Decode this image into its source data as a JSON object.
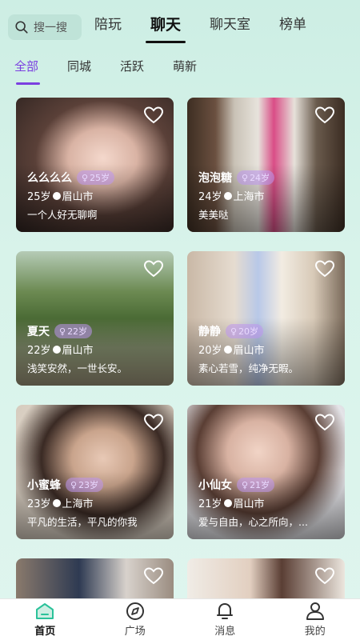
{
  "search": {
    "placeholder": "搜一搜"
  },
  "tabs": [
    {
      "label": "陪玩",
      "active": false
    },
    {
      "label": "聊天",
      "active": true
    },
    {
      "label": "聊天室",
      "active": false
    },
    {
      "label": "榜单",
      "active": false
    }
  ],
  "subtabs": [
    {
      "label": "全部",
      "active": true
    },
    {
      "label": "同城",
      "active": false
    },
    {
      "label": "活跃",
      "active": false
    },
    {
      "label": "萌新",
      "active": false
    }
  ],
  "cards": [
    {
      "name": "么么么么",
      "age_badge": "25岁",
      "age": "25岁",
      "city": "眉山市",
      "bio": "一个人好无聊啊",
      "icon": "heart-outline-icon"
    },
    {
      "name": "泡泡糖",
      "age_badge": "24岁",
      "age": "24岁",
      "city": "上海市",
      "bio": "美美哒",
      "icon": "heart-outline-icon"
    },
    {
      "name": "夏天",
      "age_badge": "22岁",
      "age": "22岁",
      "city": "眉山市",
      "bio": "浅笑安然，一世长安。",
      "icon": "heart-outline-icon"
    },
    {
      "name": "静静",
      "age_badge": "20岁",
      "age": "20岁",
      "city": "眉山市",
      "bio": "素心若雪，纯净无暇。",
      "icon": "heart-outline-icon"
    },
    {
      "name": "小蜜蜂",
      "age_badge": "23岁",
      "age": "23岁",
      "city": "上海市",
      "bio": "平凡的生活，平凡的你我",
      "icon": "heart-outline-icon"
    },
    {
      "name": "小仙女",
      "age_badge": "21岁",
      "age": "21岁",
      "city": "眉山市",
      "bio": "爱与自由，心之所向，...",
      "icon": "heart-outline-icon"
    }
  ],
  "bottom_nav": [
    {
      "label": "首页",
      "icon": "home-icon",
      "active": true
    },
    {
      "label": "广场",
      "icon": "compass-icon",
      "active": false
    },
    {
      "label": "消息",
      "icon": "bell-icon",
      "active": false
    },
    {
      "label": "我的",
      "icon": "user-icon",
      "active": false
    }
  ],
  "colors": {
    "accent": "#7b3fe0",
    "bg": "#d4f1e8",
    "nav_active": "#2bc29a"
  }
}
